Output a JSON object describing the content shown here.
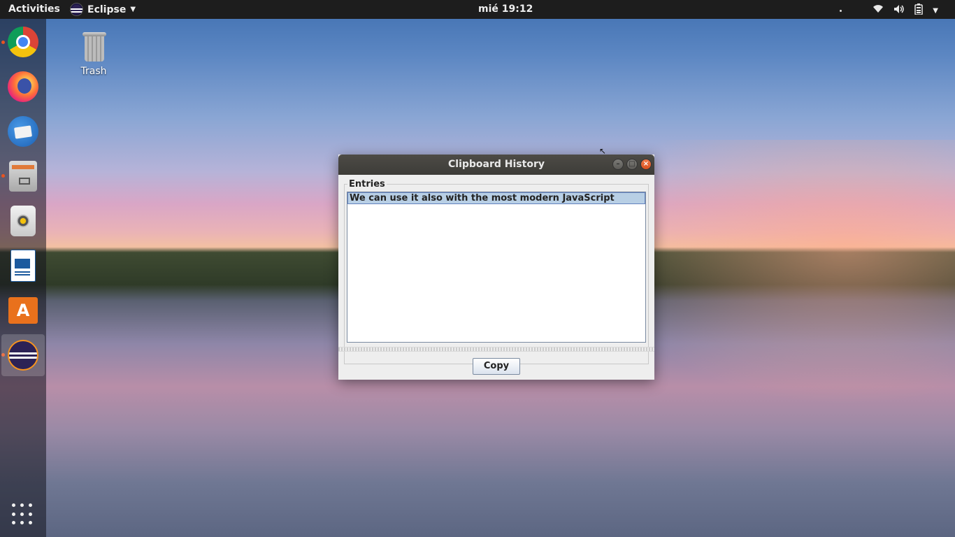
{
  "topbar": {
    "activities": "Activities",
    "app_name": "Eclipse",
    "clock": "mié 19:12"
  },
  "dock": {
    "items": [
      {
        "name": "Google Chrome",
        "icon": "chrome-icon"
      },
      {
        "name": "Firefox",
        "icon": "firefox-icon"
      },
      {
        "name": "Thunderbird",
        "icon": "thunderbird-icon"
      },
      {
        "name": "Files",
        "icon": "files-icon"
      },
      {
        "name": "Rhythmbox",
        "icon": "rhythmbox-icon"
      },
      {
        "name": "LibreOffice Writer",
        "icon": "writer-icon"
      },
      {
        "name": "Ubuntu Software",
        "icon": "store-icon",
        "glyph": "A"
      },
      {
        "name": "Eclipse",
        "icon": "eclipse-icon"
      }
    ]
  },
  "desktop": {
    "trash_label": "Trash"
  },
  "dialog": {
    "title": "Clipboard History",
    "group_label": "Entries",
    "entries": [
      "We can use it also with the most modern JavaScript"
    ],
    "copy_label": "Copy"
  },
  "colors": {
    "accent": "#e95420",
    "selection": "#b8cfe5",
    "titlebar": "#3d3c38"
  }
}
